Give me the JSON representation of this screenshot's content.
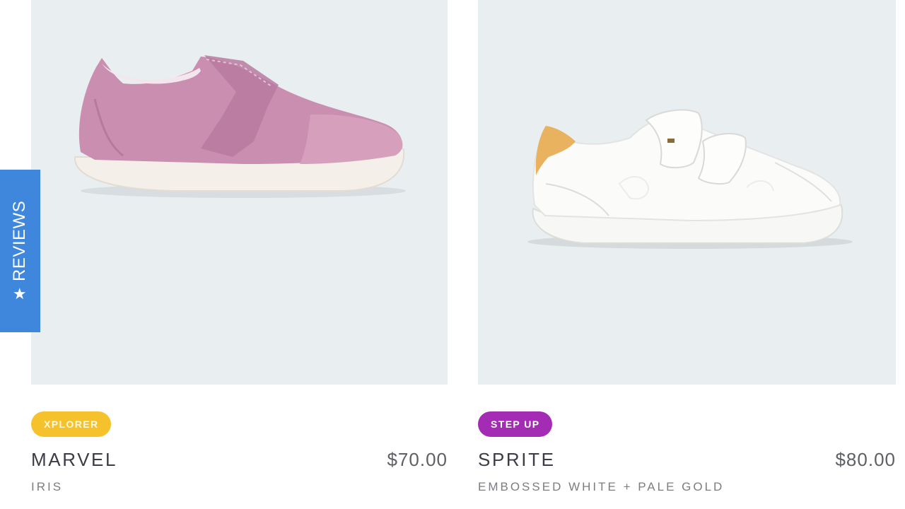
{
  "reviews_tab": {
    "label": "REVIEWS",
    "icon": "star-icon"
  },
  "colors": {
    "image_bg": "#e9eef0",
    "xplorer_badge": "#f6c22c",
    "step_up_badge": "#a42bb3",
    "reviews_tab": "#3f87dd"
  },
  "products": [
    {
      "badge": "XPLORER",
      "name": "MARVEL",
      "price": "$70.00",
      "variant": "IRIS",
      "image": "pink-shoe-image"
    },
    {
      "badge": "STEP UP",
      "name": "SPRITE",
      "price": "$80.00",
      "variant": "EMBOSSED WHITE + PALE GOLD",
      "image": "white-sneaker-image"
    }
  ]
}
